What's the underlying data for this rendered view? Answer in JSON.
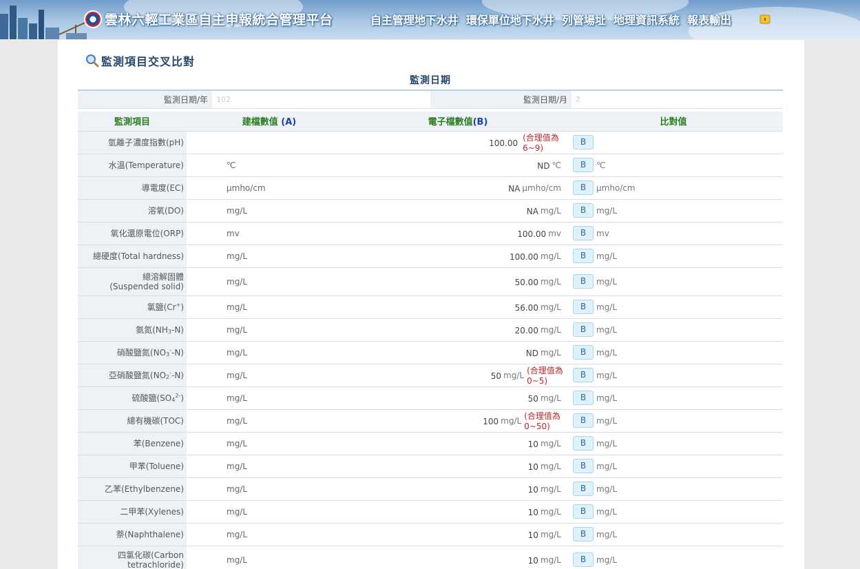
{
  "header": {
    "site_title": "雲林六輕工業區自主申報統合管理平台",
    "nav": [
      "自主管理地下水井",
      "環保單位地下水井",
      "列管場址",
      "地理資訊系統",
      "報表輸出"
    ]
  },
  "page": {
    "title": "監測項目交叉比對",
    "section_title": "監測日期",
    "date": {
      "year_label": "監測日期/年",
      "year_value": "102",
      "month_label": "監測日期/月",
      "month_value": "2"
    }
  },
  "table": {
    "headers": {
      "item": "監測項目",
      "built": "建檔數值",
      "built_mark": "(A)",
      "elec": "電子檔數值",
      "elec_mark": "(B)",
      "cmp": "比對值"
    },
    "button_label": "B",
    "rows": [
      {
        "name": "氫離子濃度指數(pH)",
        "unit_a": "",
        "value": "100.00",
        "unit_b": "",
        "note": "(合理值為6~9)",
        "unit_c": ""
      },
      {
        "name": "水溫(Temperature)",
        "unit_a": "℃",
        "value": "ND",
        "unit_b": "℃",
        "note": "",
        "unit_c": "℃"
      },
      {
        "name": "導電度(EC)",
        "unit_a": "μmho/cm",
        "value": "NA",
        "unit_b": "μmho/cm",
        "note": "",
        "unit_c": "μmho/cm"
      },
      {
        "name": "溶氧(DO)",
        "unit_a": "mg/L",
        "value": "NA",
        "unit_b": "mg/L",
        "note": "",
        "unit_c": "mg/L"
      },
      {
        "name": "氧化還原電位(ORP)",
        "unit_a": "mv",
        "value": "100.00",
        "unit_b": "mv",
        "note": "",
        "unit_c": "mv"
      },
      {
        "name": "總硬度(Total hardness)",
        "unit_a": "mg/L",
        "value": "100.00",
        "unit_b": "mg/L",
        "note": "",
        "unit_c": "mg/L"
      },
      {
        "name_line1": "總溶解固體",
        "name_line2": "(Suspended solid)",
        "unit_a": "mg/L",
        "value": "50.00",
        "unit_b": "mg/L",
        "note": "",
        "unit_c": "mg/L"
      },
      {
        "name_pre": "氯鹽(Cr",
        "name_sup": "+",
        "name_post": ")",
        "unit_a": "mg/L",
        "value": "56.00",
        "unit_b": "mg/L",
        "note": "",
        "unit_c": "mg/L"
      },
      {
        "name_pre": "氨氮(NH",
        "name_sub": "3",
        "name_post": "-N)",
        "unit_a": "mg/L",
        "value": "20.00",
        "unit_b": "mg/L",
        "note": "",
        "unit_c": "mg/L"
      },
      {
        "name_pre": "硝酸鹽氮(NO",
        "name_sub": "3",
        "name_sup": "-",
        "name_post": "-N)",
        "unit_a": "mg/L",
        "value": "ND",
        "unit_b": "mg/L",
        "note": "",
        "unit_c": "mg/L"
      },
      {
        "name_pre": "亞硝酸鹽氮(NO",
        "name_sub": "2",
        "name_sup": "-",
        "name_post": "-N)",
        "unit_a": "mg/L",
        "value": "50",
        "unit_b": "mg/L",
        "note": "(合理值為0~5)",
        "unit_c": "mg/L"
      },
      {
        "name_pre": "硫酸鹽(SO",
        "name_sub": "4",
        "name_sup": "2-",
        "name_post": ")",
        "unit_a": "mg/L",
        "value": "50",
        "unit_b": "mg/L",
        "note": "",
        "unit_c": "mg/L"
      },
      {
        "name": "總有機碳(TOC)",
        "unit_a": "mg/L",
        "value": "100",
        "unit_b": "mg/L",
        "note": "(合理值為0~50)",
        "unit_c": "mg/L"
      },
      {
        "name": "苯(Benzene)",
        "unit_a": "mg/L",
        "value": "10",
        "unit_b": "mg/L",
        "note": "",
        "unit_c": "mg/L"
      },
      {
        "name": "甲苯(Toluene)",
        "unit_a": "mg/L",
        "value": "10",
        "unit_b": "mg/L",
        "note": "",
        "unit_c": "mg/L"
      },
      {
        "name": "乙苯(Ethylbenzene)",
        "unit_a": "mg/L",
        "value": "10",
        "unit_b": "mg/L",
        "note": "",
        "unit_c": "mg/L"
      },
      {
        "name": "二甲苯(Xylenes)",
        "unit_a": "mg/L",
        "value": "10",
        "unit_b": "mg/L",
        "note": "",
        "unit_c": "mg/L"
      },
      {
        "name": "萘(Naphthalene)",
        "unit_a": "mg/L",
        "value": "10",
        "unit_b": "mg/L",
        "note": "",
        "unit_c": "mg/L"
      },
      {
        "name_line1": "四氯化碳(Carbon",
        "name_line2": "tetrachloride)",
        "unit_a": "mg/L",
        "value": "10",
        "unit_b": "mg/L",
        "note": "",
        "unit_c": "mg/L"
      }
    ]
  }
}
